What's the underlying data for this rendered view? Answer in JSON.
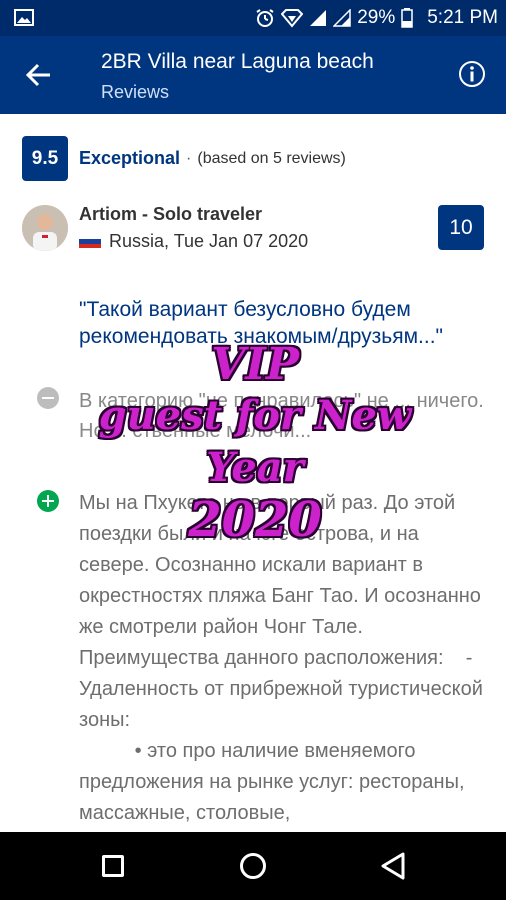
{
  "status_bar": {
    "battery_percent": "29%",
    "time": "5:21 PM",
    "icons": [
      "image-icon",
      "alarm-icon",
      "wifi-icon",
      "signal-icon",
      "battery-icon"
    ]
  },
  "app_bar": {
    "title": "2BR Villa near Laguna beach",
    "subtitle": "Reviews",
    "back_icon": "arrow-left-icon",
    "info_icon": "info-icon"
  },
  "summary": {
    "score": "9.5",
    "label": "Exceptional",
    "separator": "·",
    "count_text": "(based on 5 reviews)"
  },
  "review": {
    "reviewer": "Artiom - Solo traveler",
    "meta": "Russia, Tue Jan 07 2020",
    "score": "10",
    "quote": "\"Такой вариант безусловно будем рекомендовать знакомым/друзьям...\"",
    "negative": "В категорию \"не понравилось\" не ... ничего. Но ... ственные мелочи...",
    "positive": "Мы на Пхукете не в первый раз. До этой поездки были и на юге острова, и на севере. Осознанно искали вариант в окрестностях пляжа Банг Тао. И осознанно же смотрели район Чонг Тале. Преимущества данного расположения:    - Удаленность от прибрежной туристической зоны:\n          • это про наличие вменяемого предложения на рынке услуг: рестораны, массажные, столовые,"
  },
  "overlay": {
    "line1": "VIP",
    "line2": "guest for New Year",
    "line3": "2020"
  },
  "colors": {
    "brand": "#003580",
    "status_bar": "#002b6b",
    "positive": "#00a650",
    "overlay": "#cc22cc"
  }
}
